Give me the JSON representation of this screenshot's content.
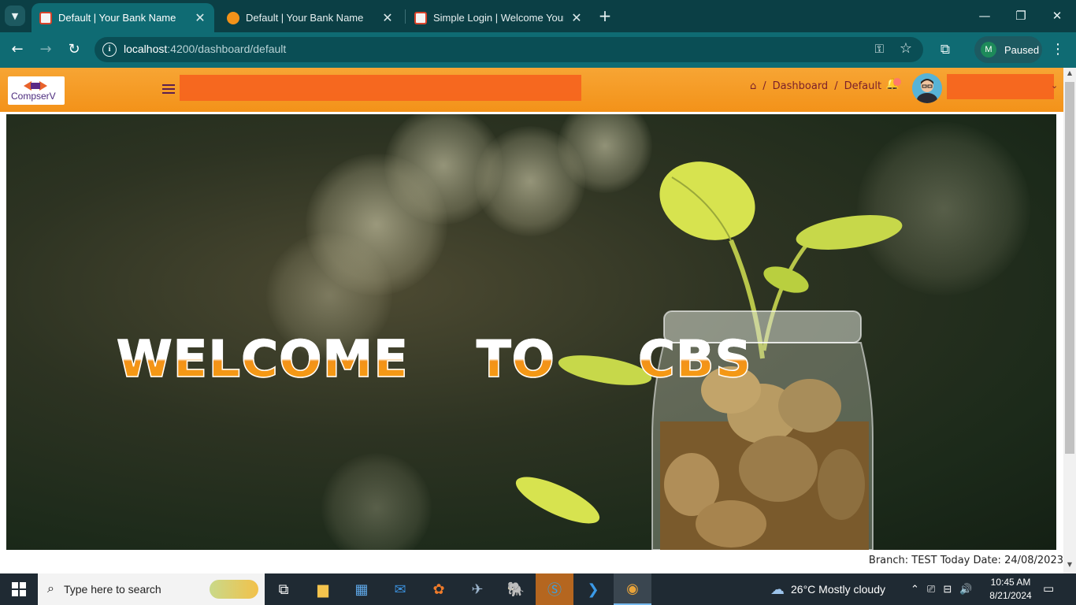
{
  "browser": {
    "tabs": [
      {
        "title": "Default | Your Bank Name",
        "active": true
      },
      {
        "title": "Default | Your Bank Name",
        "active": false
      },
      {
        "title": "Simple Login | Welcome Your Ba",
        "active": false
      }
    ],
    "url_host": "localhost",
    "url_rest": ":4200/dashboard/default",
    "profile_initial": "M",
    "profile_status": "Paused"
  },
  "app": {
    "logo_text": "CompserV",
    "breadcrumb": [
      "Dashboard",
      "Default"
    ],
    "hero_words": [
      "WELCOME",
      "TO",
      "CBS"
    ],
    "footer_info": "Branch: TEST Today Date: 24/08/2023",
    "colors": {
      "header": "#f39219",
      "accent": "#f6651f",
      "crumb": "#7a1f2b"
    }
  },
  "taskbar": {
    "search_placeholder": "Type here to search",
    "weather": "26°C  Mostly cloudy",
    "time": "10:45 AM",
    "date": "8/21/2024",
    "apps": [
      "task-view-icon",
      "file-explorer-icon",
      "store-icon",
      "mail-icon",
      "xampp-icon",
      "app-icon",
      "postgres-icon",
      "skype-icon",
      "vscode-icon",
      "chrome-icon"
    ]
  }
}
